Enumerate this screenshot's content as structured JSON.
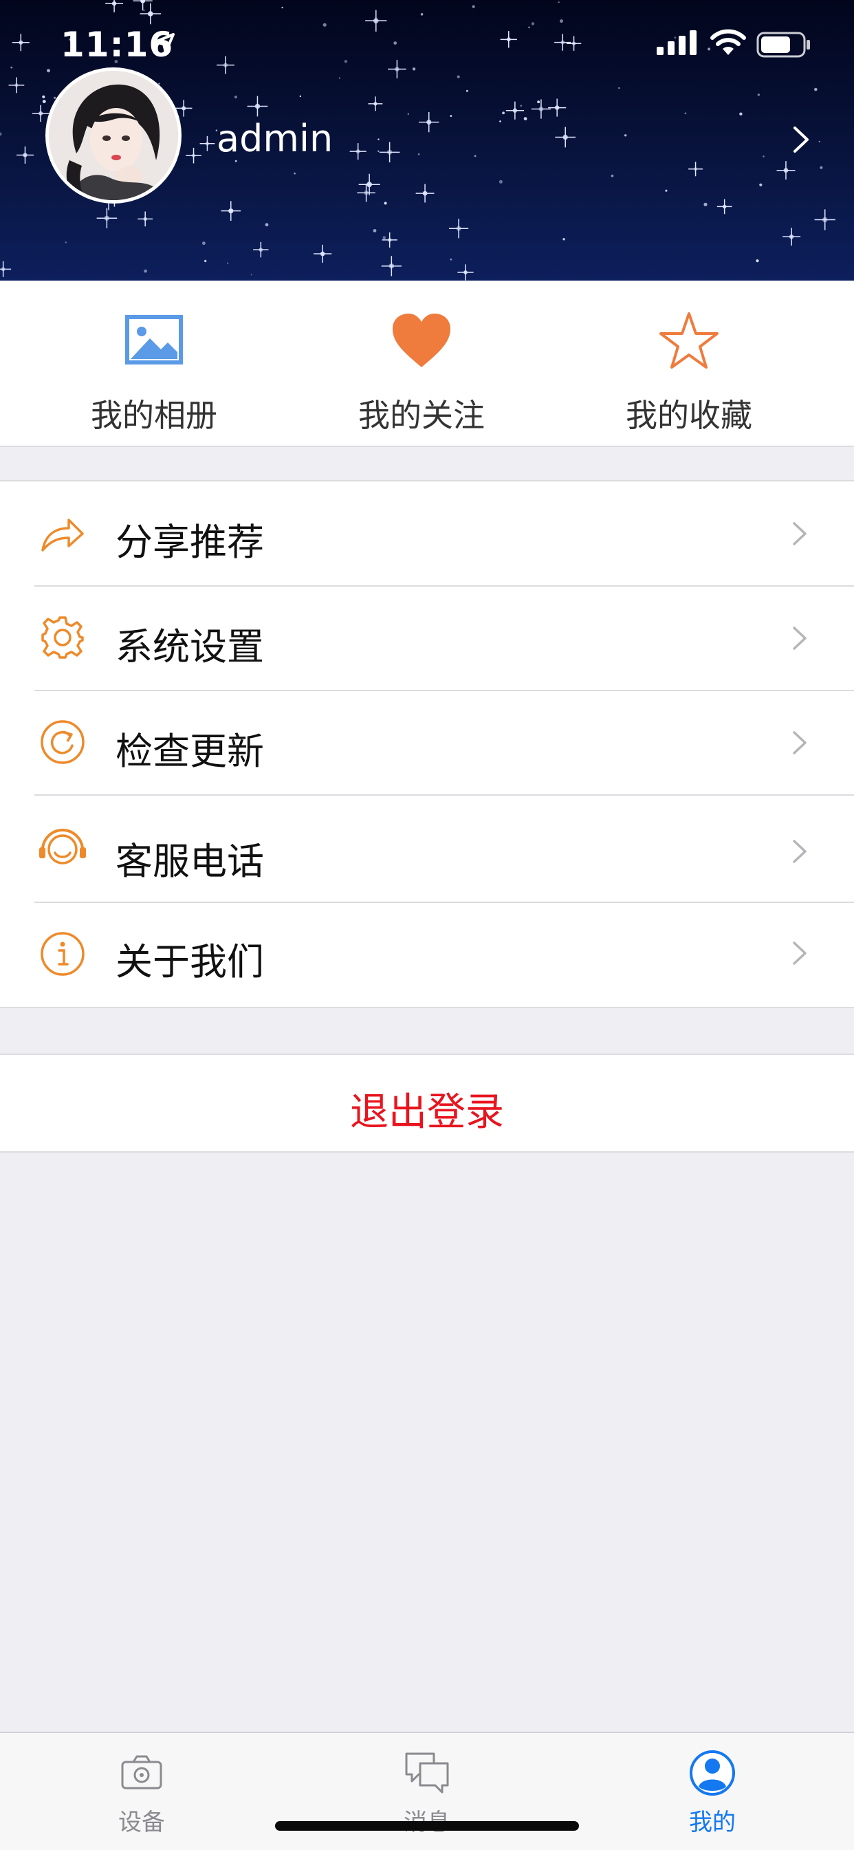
{
  "status_bar": {
    "time": "11:16"
  },
  "profile": {
    "username": "admin"
  },
  "quick_actions": [
    {
      "label": "我的相册",
      "icon": "photo-album-icon"
    },
    {
      "label": "我的关注",
      "icon": "heart-icon"
    },
    {
      "label": "我的收藏",
      "icon": "star-icon"
    }
  ],
  "menu": [
    {
      "label": "分享推荐",
      "icon": "share-icon"
    },
    {
      "label": "系统设置",
      "icon": "gear-icon"
    },
    {
      "label": "检查更新",
      "icon": "refresh-icon"
    },
    {
      "label": "客服电话",
      "icon": "headset-icon"
    },
    {
      "label": "关于我们",
      "icon": "info-icon"
    }
  ],
  "logout": {
    "label": "退出登录"
  },
  "tabs": [
    {
      "label": "设备",
      "icon": "camera-icon",
      "active": false
    },
    {
      "label": "消息",
      "icon": "message-icon",
      "active": false
    },
    {
      "label": "我的",
      "icon": "user-icon",
      "active": true
    }
  ],
  "colors": {
    "accent_orange": "#ee8a2a",
    "heart": "#ef7b3d",
    "album_blue": "#4a90e2",
    "logout_red": "#e8141e",
    "tab_active": "#1478f0",
    "header_bg": "#071137"
  }
}
